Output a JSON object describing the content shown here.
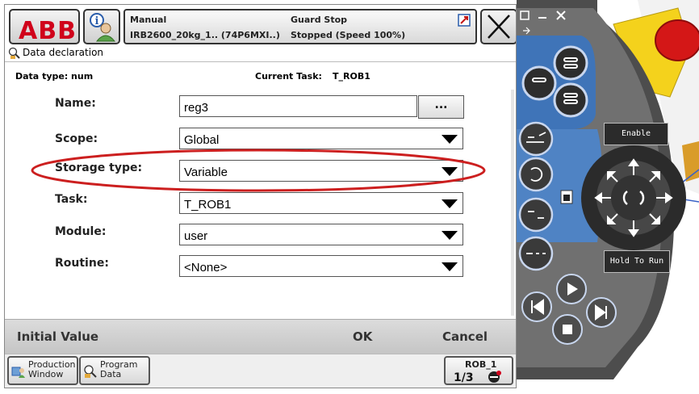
{
  "brand": {
    "logo_text": "ABB"
  },
  "status": {
    "mode": "Manual",
    "robot": "IRB2600_20kg_1.. (74P6MXI..)",
    "guard": "Guard Stop",
    "state": "Stopped (Speed 100%)"
  },
  "window": {
    "title": "Data declaration"
  },
  "meta": {
    "data_type": "Data type: num",
    "current_task_label": "Current Task:",
    "current_task_value": "T_ROB1"
  },
  "form": {
    "name_label": "Name:",
    "name_value": "reg3",
    "dots_label": "...",
    "scope_label": "Scope:",
    "scope_value": "Global",
    "storage_label": "Storage type:",
    "storage_value": "Variable",
    "task_label": "Task:",
    "task_value": "T_ROB1",
    "module_label": "Module:",
    "module_value": "user",
    "routine_label": "Routine:",
    "routine_value": "<None>"
  },
  "actions": {
    "initial_value": "Initial Value",
    "ok": "OK",
    "cancel": "Cancel"
  },
  "taskbar": {
    "production_window": [
      "Production",
      "Window"
    ],
    "program_data": [
      "Program",
      "Data"
    ],
    "rob_label": "ROB_1"
  },
  "pendant": {
    "enable_label": "Enable",
    "hold_label": "Hold To Run"
  },
  "colors": {
    "abb_red": "#d0021b",
    "pendant_blue": "#3f74b8",
    "highlight_ellipse": "#cc1f1f"
  }
}
